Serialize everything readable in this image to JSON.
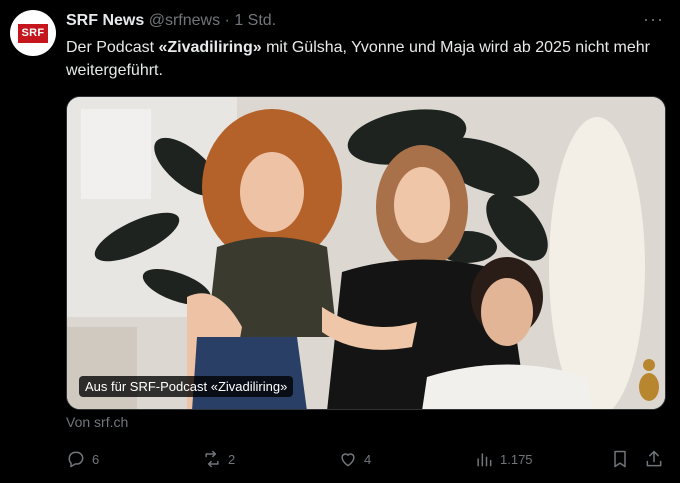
{
  "account": {
    "avatar_text": "SRF",
    "name": "SRF News",
    "handle": "@srfnews",
    "separator": "·",
    "time": "1 Std.",
    "more": "···"
  },
  "tweet": {
    "text_part1": "Der Podcast ",
    "text_bold": "«Zivadiliring»",
    "text_part2": " mit Gülsha, Yvonne und Maja wird ab 2025 nicht mehr weitergeführt."
  },
  "card": {
    "caption": "Aus für SRF-Podcast «Zivadiliring»",
    "source": "Von srf.ch"
  },
  "actions": {
    "replies": "6",
    "reposts": "2",
    "likes": "4",
    "views": "1.175"
  },
  "icons": {
    "reply": "reply-icon",
    "repost": "repost-icon",
    "like": "heart-icon",
    "views": "views-icon",
    "bookmark": "bookmark-icon",
    "share": "share-icon"
  },
  "colors": {
    "background": "#000000",
    "text": "#e7e9ea",
    "muted": "#71767b",
    "brand": "#c4161c"
  }
}
